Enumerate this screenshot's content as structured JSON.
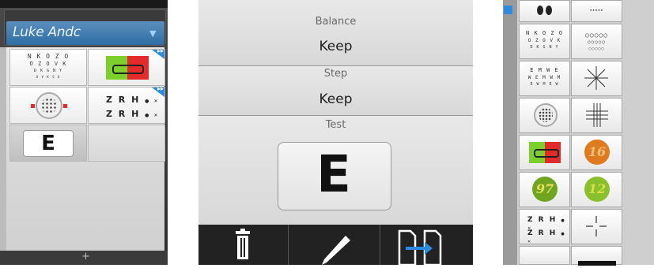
{
  "user": {
    "name": "Luke Andc"
  },
  "left_panel": {
    "charts": [
      {
        "type": "letters",
        "rows": [
          "N K O Z O",
          "O Z O V K",
          "D K G N Y",
          "O V K S O"
        ]
      },
      {
        "type": "red-green"
      },
      {
        "type": "astigmatism"
      },
      {
        "type": "zrh",
        "rows": [
          "Z R H",
          "Z R H"
        ]
      },
      {
        "type": "single-e",
        "letter": "E"
      }
    ],
    "add_symbol": "+"
  },
  "middle_panel": {
    "sections": [
      {
        "label": "Balance",
        "value": "Keep"
      },
      {
        "label": "Step",
        "value": "Keep"
      },
      {
        "label": "Test",
        "letter": "E"
      }
    ],
    "toolbar": [
      {
        "icon": "trash-icon"
      },
      {
        "icon": "pen-icon"
      },
      {
        "icon": "copy-forward-icon"
      }
    ]
  },
  "right_panel": {
    "charts": [
      {
        "type": "letters",
        "rows": [
          "N K O Z O",
          "O Z O V K",
          "D K G N Y"
        ]
      },
      {
        "type": "circles"
      },
      {
        "type": "e-letters",
        "rows": [
          "E M W E",
          "W E M W M",
          "E W M E W"
        ]
      },
      {
        "type": "fan"
      },
      {
        "type": "astigmatism"
      },
      {
        "type": "cross-grid"
      },
      {
        "type": "red-green"
      },
      {
        "type": "ishihara",
        "number": "16"
      },
      {
        "type": "ishihara",
        "number": "97"
      },
      {
        "type": "ishihara",
        "number": "12"
      },
      {
        "type": "zrh",
        "rows": [
          "Z R H",
          "Z R H"
        ]
      },
      {
        "type": "cross"
      }
    ]
  },
  "colors": {
    "accent": "#2a8be0",
    "user_bar": "#3e7db3",
    "toolbar": "#222222",
    "red": "#e32b2b",
    "green": "#7bd02b"
  }
}
